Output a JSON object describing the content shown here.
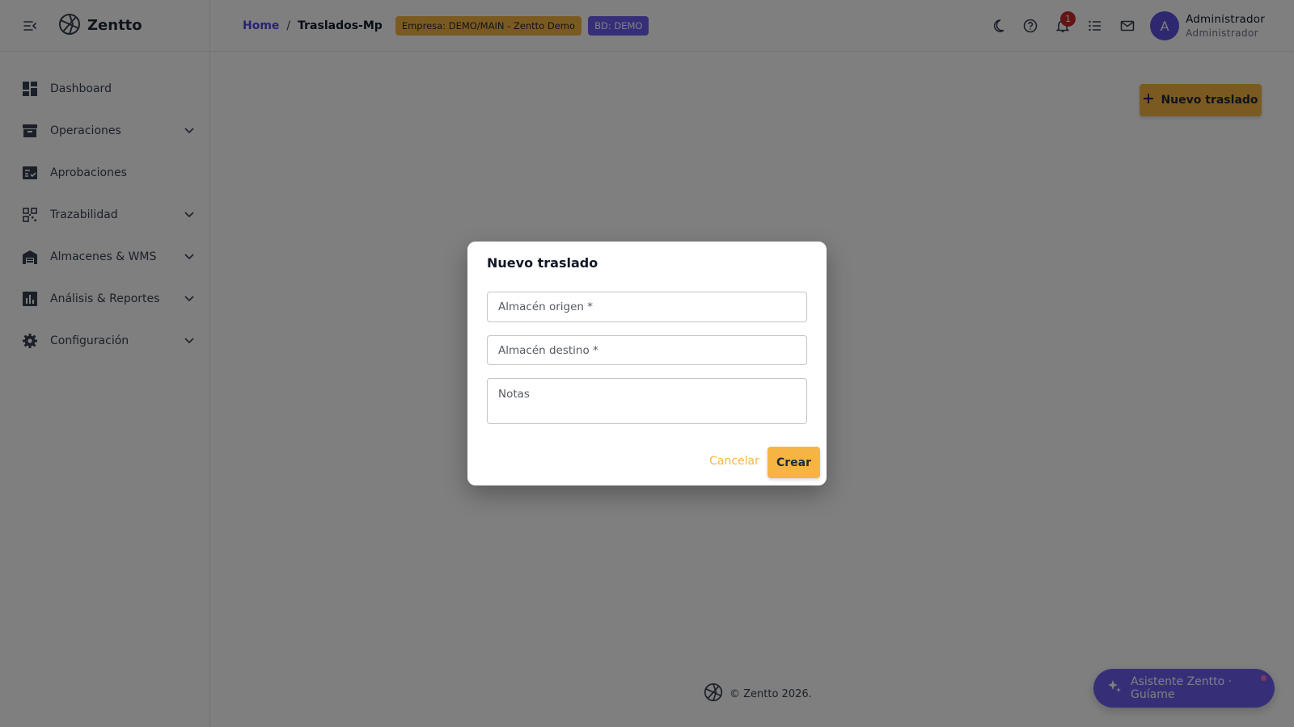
{
  "app": {
    "brand": "Zentto"
  },
  "sidebar": {
    "items": [
      {
        "label": "Dashboard",
        "icon": "dashboard-icon",
        "expandable": false
      },
      {
        "label": "Operaciones",
        "icon": "archive-icon",
        "expandable": true
      },
      {
        "label": "Aprobaciones",
        "icon": "checklist-icon",
        "expandable": false
      },
      {
        "label": "Trazabilidad",
        "icon": "qr-code-icon",
        "expandable": true
      },
      {
        "label": "Almacenes & WMS",
        "icon": "warehouse-icon",
        "expandable": true
      },
      {
        "label": "Análisis & Reportes",
        "icon": "bar-chart-icon",
        "expandable": true
      },
      {
        "label": "Configuración",
        "icon": "gear-icon",
        "expandable": true
      }
    ]
  },
  "header": {
    "breadcrumb_home": "Home",
    "breadcrumb_sep": "/",
    "breadcrumb_current": "Traslados-Mp",
    "badge_empresa": "Empresa: DEMO/MAIN - Zentto Demo",
    "badge_bd": "BD: DEMO",
    "notifications_count": "1",
    "user": {
      "initial": "A",
      "name": "Administrador",
      "role": "Administrador"
    }
  },
  "main": {
    "new_button_label": "Nuevo traslado",
    "footer_text": "© Zentto 2026.",
    "assistant_label": "Asistente Zentto · Guíame"
  },
  "dialog": {
    "title": "Nuevo traslado",
    "origen_placeholder": "Almacén origen *",
    "destino_placeholder": "Almacén destino *",
    "notas_placeholder": "Notas",
    "cancel_label": "Cancelar",
    "create_label": "Crear"
  },
  "colors": {
    "accent": "#f6b543",
    "primary": "#6d5ff0",
    "link": "#4f46e5",
    "badge_danger": "#c62828"
  }
}
